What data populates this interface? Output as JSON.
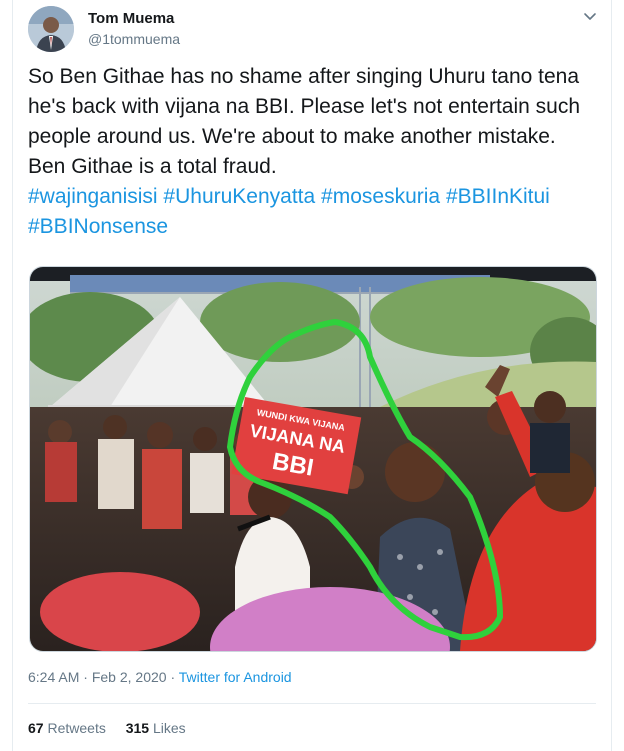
{
  "author": {
    "display_name": "Tom Muema",
    "handle": "@1tommuema"
  },
  "tweet": {
    "text_intro": "So Ben Githae has no shame after singing Uhuru tano tena he's back with vijana na BBI. Please let's not entertain such people around us. We're about to make another mistake. Ben Githae is a total fraud.",
    "hashtags": [
      "#wajinganisisi",
      "#UhuruKenyatta",
      "#moseskuria",
      "#BBIInKitui",
      "#BBINonsense"
    ]
  },
  "media": {
    "sign_top": "WUNDI KWA VIJANA",
    "sign_line1": "VIJANA NA",
    "sign_line2": "BBI"
  },
  "meta": {
    "time": "6:24 AM",
    "separator": "·",
    "date": "Feb 2, 2020",
    "source": "Twitter for Android"
  },
  "stats": {
    "retweets_count": "67",
    "retweets_label": "Retweets",
    "likes_count": "315",
    "likes_label": "Likes"
  },
  "colors": {
    "link": "#1b95e0",
    "muted": "#657786",
    "text": "#14171a",
    "highlight": "#2fd13c"
  }
}
